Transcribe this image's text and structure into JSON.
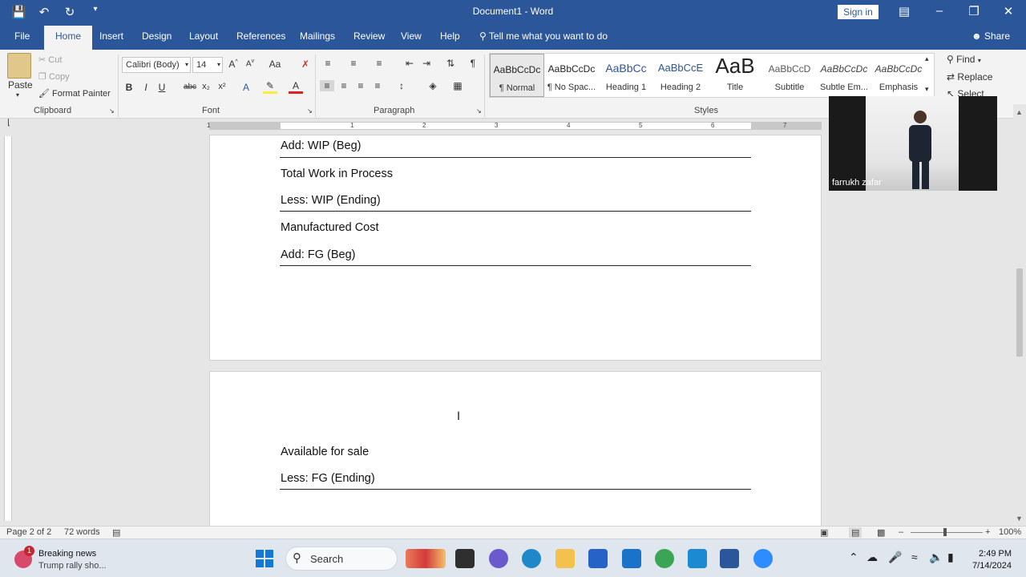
{
  "window": {
    "title": "Document1  -  Word",
    "signin_label": "Sign in"
  },
  "tabs": [
    {
      "label": "File"
    },
    {
      "label": "Home"
    },
    {
      "label": "Insert"
    },
    {
      "label": "Design"
    },
    {
      "label": "Layout"
    },
    {
      "label": "References"
    },
    {
      "label": "Mailings"
    },
    {
      "label": "Review"
    },
    {
      "label": "View"
    },
    {
      "label": "Help"
    }
  ],
  "tell_me": "Tell me what you want to do",
  "share_label": "Share",
  "ribbon": {
    "clipboard": {
      "paste": "Paste",
      "cut": "Cut",
      "copy": "Copy",
      "format_painter": "Format Painter",
      "group": "Clipboard"
    },
    "font": {
      "font_name": "Calibri (Body)",
      "font_size": "14",
      "group": "Font",
      "bold": "B",
      "italic": "I",
      "underline": "U",
      "strike": "abc",
      "sub": "x₂",
      "sup": "x²",
      "change_case": "Aa"
    },
    "paragraph": {
      "group": "Paragraph"
    },
    "styles": {
      "group": "Styles",
      "items": [
        {
          "preview": "AaBbCcDc",
          "name": "¶ Normal"
        },
        {
          "preview": "AaBbCcDc",
          "name": "¶ No Spac..."
        },
        {
          "preview": "AaBbCc",
          "name": "Heading 1"
        },
        {
          "preview": "AaBbCcE",
          "name": "Heading 2"
        },
        {
          "preview": "AaB",
          "name": "Title"
        },
        {
          "preview": "AaBbCcD",
          "name": "Subtitle"
        },
        {
          "preview": "AaBbCcDc",
          "name": "Subtle Em..."
        },
        {
          "preview": "AaBbCcDc",
          "name": "Emphasis"
        }
      ]
    },
    "editing": {
      "find": "Find",
      "replace": "Replace",
      "select": "Select"
    }
  },
  "ruler": {
    "numbers": [
      "1",
      "1",
      "2",
      "3",
      "4",
      "5",
      "6",
      "7"
    ]
  },
  "document": {
    "page1_lines": [
      "Add: WIP (Beg)",
      "Total Work in Process",
      "Less: WIP (Ending)",
      "Manufactured Cost",
      "Add: FG (Beg)"
    ],
    "page2_lines": [
      "Available for sale",
      "Less: FG (Ending)"
    ]
  },
  "video": {
    "participant": "farrukh zafar"
  },
  "status": {
    "page": "Page 2 of 2",
    "words": "72 words",
    "zoom": "100%"
  },
  "taskbar": {
    "news_badge": "1",
    "news_title": "Breaking news",
    "news_sub": "Trump rally sho...",
    "search": "Search",
    "time": "2:49 PM",
    "date": "7/14/2024"
  },
  "colors": {
    "accent": "#2b579a"
  }
}
